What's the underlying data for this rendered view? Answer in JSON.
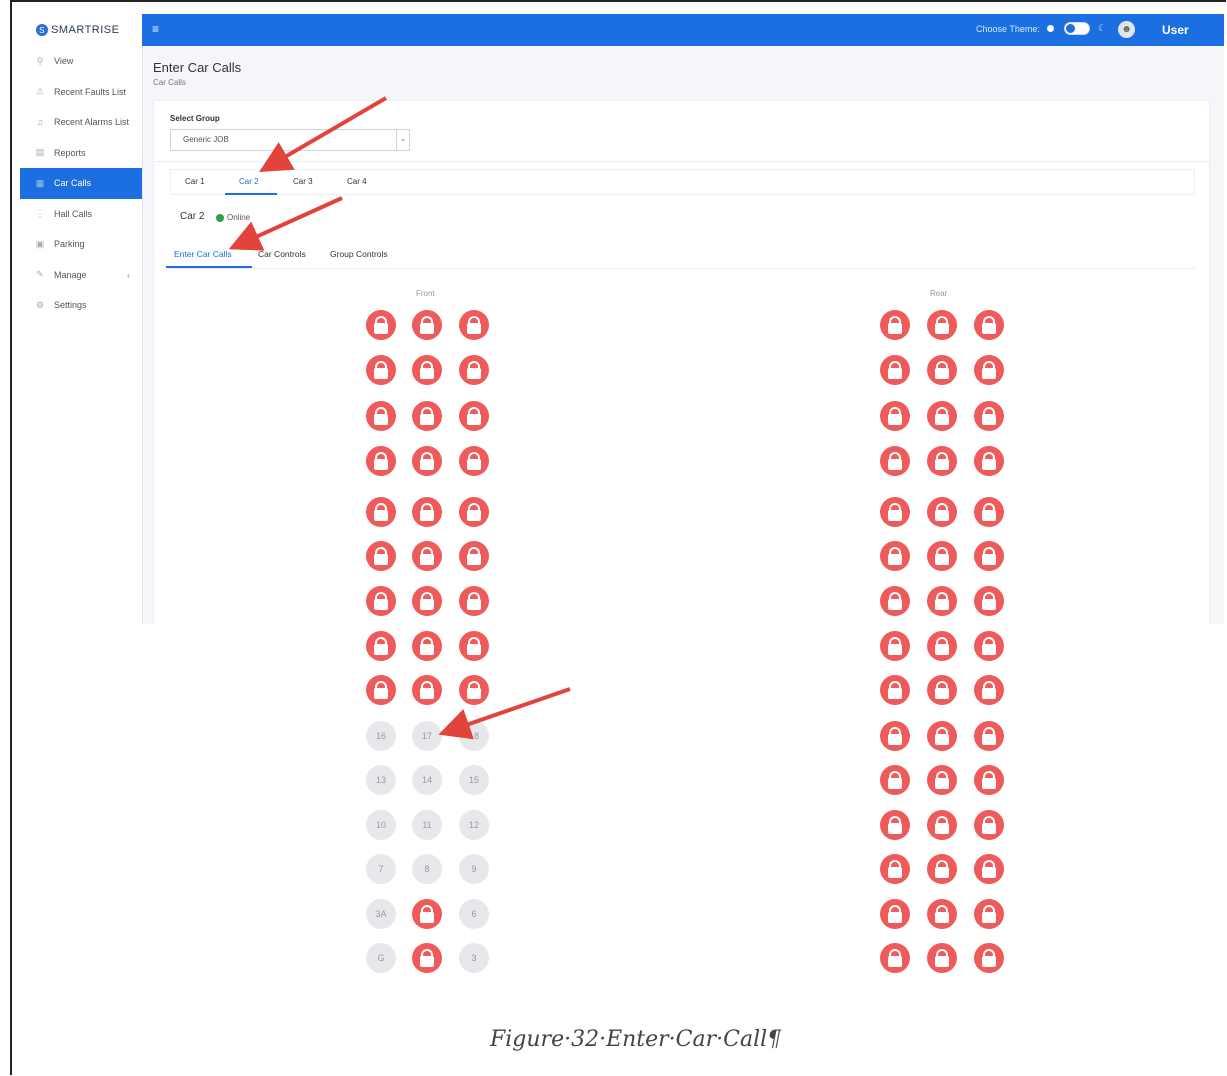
{
  "brand": {
    "logo_letter": "S",
    "name": "SMARTRISE"
  },
  "sidebar": {
    "items": [
      {
        "label": "View",
        "icon": "search-icon",
        "glyph": "⚲"
      },
      {
        "label": "Recent Faults List",
        "icon": "warning-icon",
        "glyph": "⚠"
      },
      {
        "label": "Recent Alarms List",
        "icon": "bell-icon",
        "glyph": "♫"
      },
      {
        "label": "Reports",
        "icon": "report-icon",
        "glyph": "▤"
      },
      {
        "label": "Car Calls",
        "icon": "car-calls-icon",
        "glyph": "▦",
        "active": true
      },
      {
        "label": "Hall Calls",
        "icon": "hall-calls-icon",
        "glyph": "⋮"
      },
      {
        "label": "Parking",
        "icon": "parking-icon",
        "glyph": "▣"
      },
      {
        "label": "Manage",
        "icon": "wrench-icon",
        "glyph": "✎",
        "caret": "‹"
      },
      {
        "label": "Settings",
        "icon": "gear-icon",
        "glyph": "⚙"
      }
    ]
  },
  "topbar": {
    "menu_glyph": "≡",
    "theme_label": "Choose Theme:",
    "moon_glyph": "☾",
    "avatar_glyph": "☻",
    "user_label": "User"
  },
  "page": {
    "title": "Enter Car Calls",
    "subtitle": "Car Calls"
  },
  "group": {
    "label": "Select Group",
    "selected": "Generic JOB",
    "arrow": "⌄"
  },
  "car_tabs": [
    "Car 1",
    "Car 2",
    "Car 3",
    "Car 4"
  ],
  "car_status": {
    "name": "Car 2",
    "status": "Online"
  },
  "sub_tabs": [
    "Enter Car Calls",
    "Car Controls",
    "Group Controls"
  ],
  "columns": {
    "front": "Front",
    "rear": "Rear"
  },
  "front_floors": [
    "16",
    "17",
    "18",
    "13",
    "14",
    "15",
    "10",
    "11",
    "12",
    "7",
    "8",
    "9",
    "3A",
    "",
    "6",
    "G",
    "",
    "3"
  ],
  "caption": "Figure·32·Enter·Car·Call¶",
  "colors": {
    "accent": "#1b6fe0",
    "lock_red": "#ef5a5a",
    "online_green": "#2e9e4f",
    "arrow_red": "#e2433b"
  }
}
